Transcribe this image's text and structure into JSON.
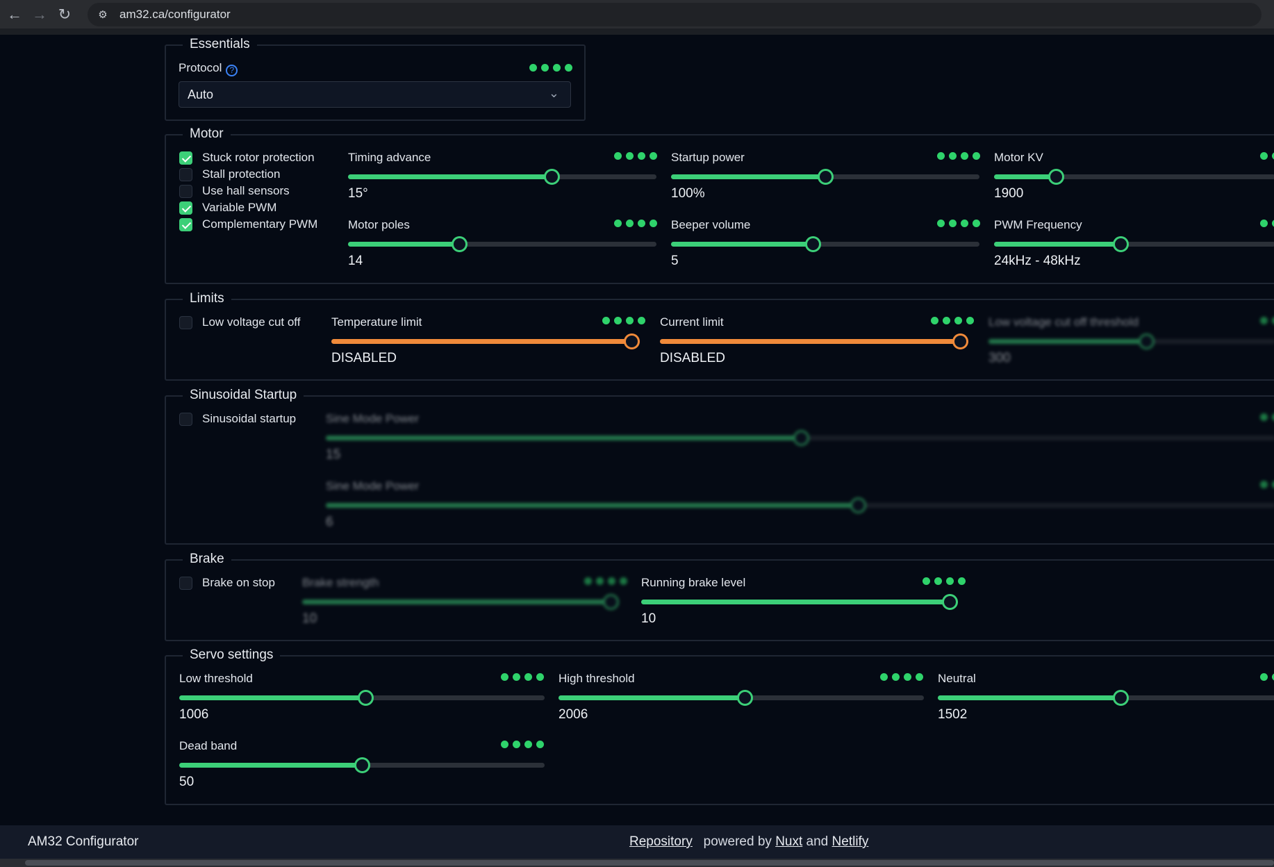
{
  "browser": {
    "url": "am32.ca/configurator",
    "back_icon": "←",
    "forward_icon": "→",
    "reload_icon": "↻",
    "site_icon": "⚙"
  },
  "essentials": {
    "legend": "Essentials",
    "protocol_label": "Protocol",
    "protocol_value": "Auto"
  },
  "motor": {
    "legend": "Motor",
    "checkboxes": [
      {
        "label": "Stuck rotor protection",
        "checked": true
      },
      {
        "label": "Stall protection",
        "checked": false
      },
      {
        "label": "Use hall sensors",
        "checked": false
      },
      {
        "label": "Variable PWM",
        "checked": true
      },
      {
        "label": "Complementary PWM",
        "checked": true
      }
    ],
    "sliders": [
      {
        "label": "Timing advance",
        "value": "15°",
        "level": 0.66
      },
      {
        "label": "Startup power",
        "value": "100%",
        "level": 0.5
      },
      {
        "label": "Motor KV",
        "value": "1900",
        "level": 0.22
      },
      {
        "label": "Motor poles",
        "value": "14",
        "level": 0.36
      },
      {
        "label": "Beeper volume",
        "value": "5",
        "level": 0.46
      },
      {
        "label": "PWM Frequency",
        "value": "24kHz - 48kHz",
        "level": 0.45
      }
    ]
  },
  "limits": {
    "legend": "Limits",
    "checkbox_label": "Low voltage cut off",
    "sliders": [
      {
        "label": "Temperature limit",
        "value": "DISABLED",
        "level": 1.0
      },
      {
        "label": "Current limit",
        "value": "DISABLED",
        "level": 1.0
      },
      {
        "label": "Low voltage cut off threshold",
        "value": "300",
        "level": 0.55
      }
    ]
  },
  "sinusoidal": {
    "legend": "Sinusoidal Startup",
    "checkbox_label": "Sinusoidal startup",
    "sliders": [
      {
        "label": "Sine Mode Power",
        "value": "15",
        "level": 0.5
      },
      {
        "label": "Sine Mode Power",
        "value": "6",
        "level": 0.56
      }
    ]
  },
  "brake": {
    "legend": "Brake",
    "checkbox_label": "Brake on stop",
    "sliders": [
      {
        "label": "Brake strength",
        "value": "10",
        "level": 1.0
      },
      {
        "label": "Running brake level",
        "value": "10",
        "level": 1.0
      }
    ]
  },
  "servo": {
    "legend": "Servo settings",
    "sliders": [
      {
        "label": "Low threshold",
        "value": "1006",
        "level": 0.51
      },
      {
        "label": "High threshold",
        "value": "2006",
        "level": 0.51
      },
      {
        "label": "Neutral",
        "value": "1502",
        "level": 0.5
      },
      {
        "label": "Dead band",
        "value": "50",
        "level": 0.5
      }
    ]
  },
  "footer": {
    "title": "AM32 Configurator",
    "repo_link": "Repository",
    "powered_by": "powered by",
    "nuxt_link": "Nuxt",
    "and_text": "and",
    "netlify_link": "Netlify"
  },
  "colors": {
    "accent": "#3ccf78",
    "warning": "#f08a3a",
    "background": "#050a14"
  }
}
